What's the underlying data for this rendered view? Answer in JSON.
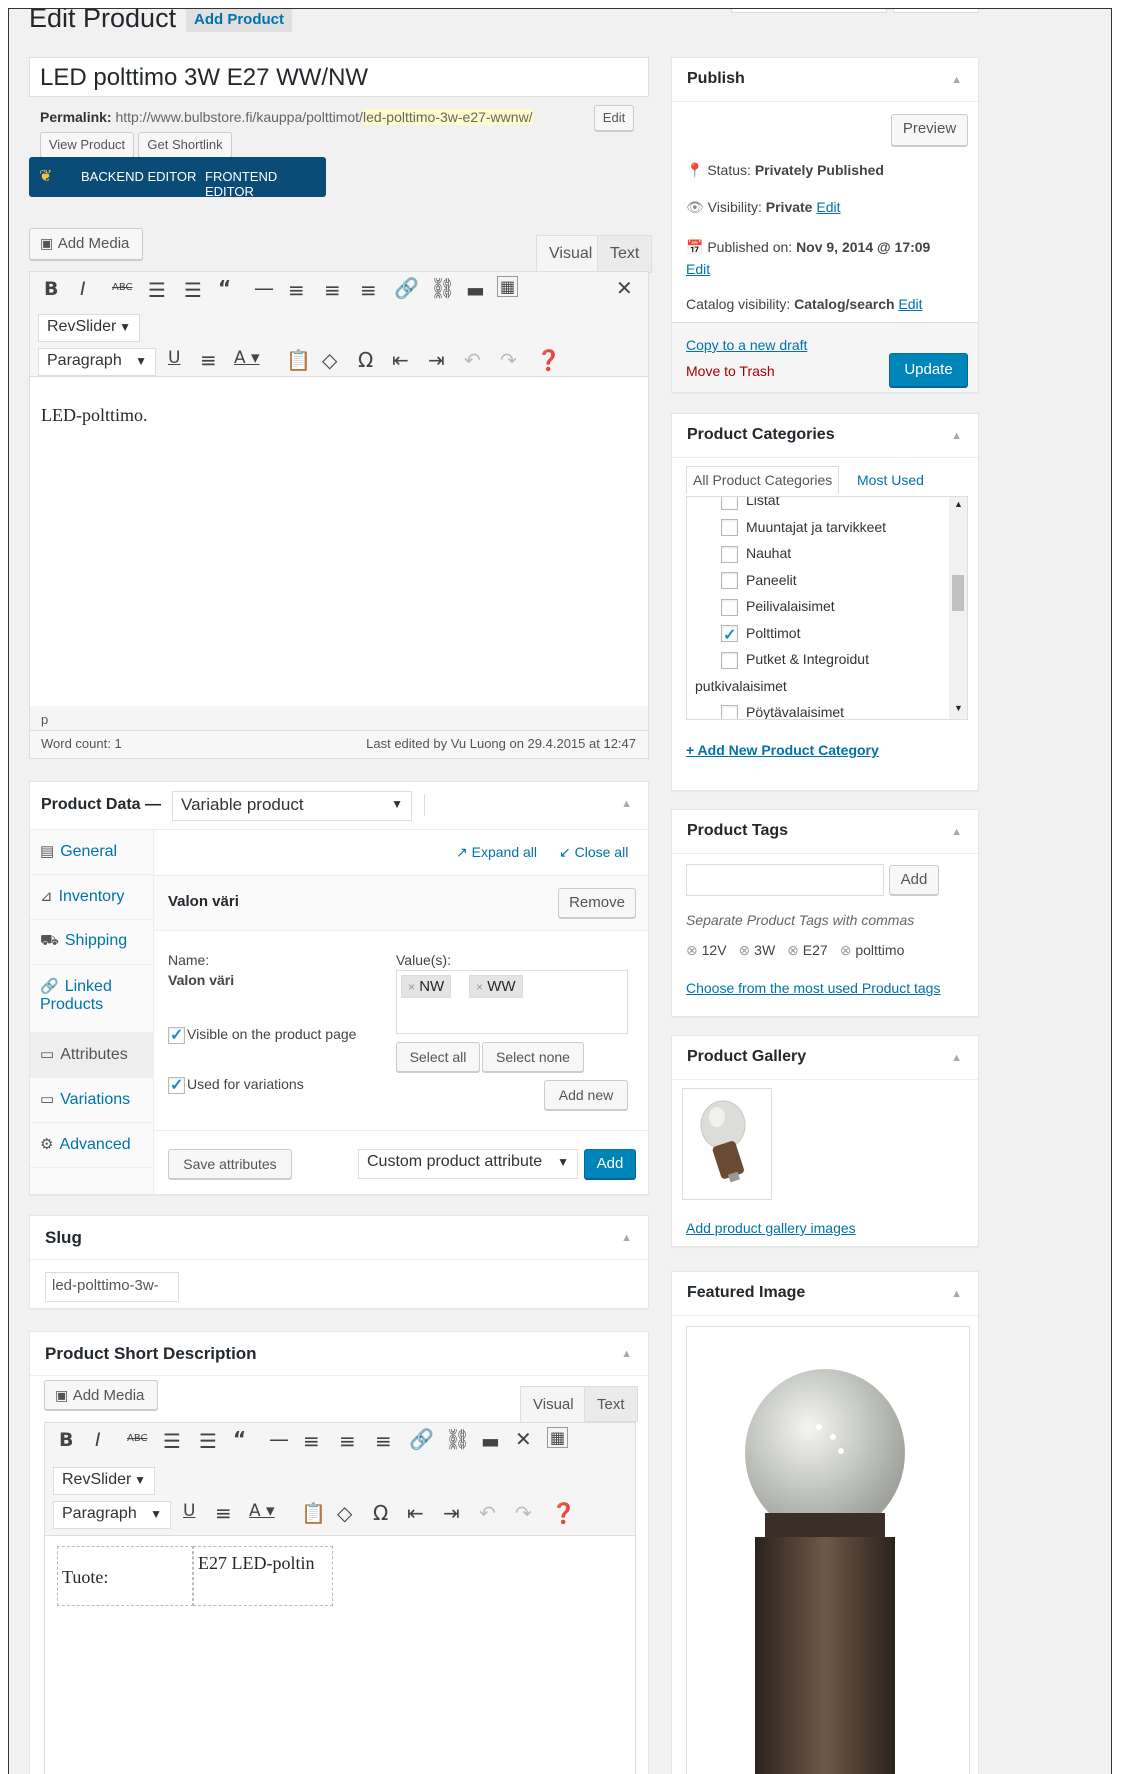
{
  "page": {
    "title": "Edit Product",
    "add_new": "Add Product"
  },
  "post": {
    "title": "LED polttimo 3W E27 WW/NW",
    "permalink_label": "Permalink:",
    "permalink_base": "http://www.bulbstore.fi/kauppa/polttimot/",
    "permalink_slug": "led-polttimo-3w-e27-wwnw/",
    "edit_label": "Edit",
    "view_product": "View Product",
    "get_shortlink": "Get Shortlink"
  },
  "composer": {
    "backend": "BACKEND EDITOR",
    "frontend": "FRONTEND EDITOR"
  },
  "editor": {
    "add_media": "Add Media",
    "tab_visual": "Visual",
    "tab_text": "Text",
    "revslider": "RevSlider",
    "format": "Paragraph",
    "content": "LED-polttimo.",
    "path": "p",
    "word_count": "Word count: 1",
    "last_edited": "Last edited by Vu Luong on 29.4.2015 at 12:47"
  },
  "product_data": {
    "label": "Product Data —",
    "type": "Variable product",
    "tabs": [
      "General",
      "Inventory",
      "Shipping",
      "Linked Products",
      "Attributes",
      "Variations",
      "Advanced"
    ],
    "expand_all": "Expand all",
    "close_all": "Close all",
    "attribute_title": "Valon väri",
    "remove": "Remove",
    "name_label": "Name:",
    "name_value": "Valon väri",
    "values_label": "Value(s):",
    "values": [
      "NW",
      "WW"
    ],
    "visible_label": "Visible on the product page",
    "variations_label": "Used for variations",
    "select_all": "Select all",
    "select_none": "Select none",
    "add_new": "Add new",
    "save_attributes": "Save attributes",
    "custom_attribute": "Custom product attribute",
    "add": "Add"
  },
  "slug": {
    "title": "Slug",
    "value": "led-polttimo-3w-"
  },
  "short_desc": {
    "title": "Product Short Description",
    "add_media": "Add Media",
    "tab_visual": "Visual",
    "tab_text": "Text",
    "revslider": "RevSlider",
    "format": "Paragraph",
    "cell1": "Tuote:",
    "cell2": "E27 LED-poltin"
  },
  "publish": {
    "title": "Publish",
    "preview": "Preview",
    "status_label": "Status:",
    "status_value": "Privately Published",
    "visibility_label": "Visibility:",
    "visibility_value": "Private",
    "edit": "Edit",
    "published_label": "Published on:",
    "published_value": "Nov 9, 2014 @ 17:09",
    "catalog_label": "Catalog visibility:",
    "catalog_value": "Catalog/search",
    "copy_draft": "Copy to a new draft",
    "trash": "Move to Trash",
    "update": "Update"
  },
  "categories": {
    "title": "Product Categories",
    "tab_all": "All Product Categories",
    "tab_used": "Most Used",
    "items": [
      {
        "label": "Listat",
        "checked": false
      },
      {
        "label": "Muuntajat ja tarvikkeet",
        "checked": false
      },
      {
        "label": "Nauhat",
        "checked": false
      },
      {
        "label": "Paneelit",
        "checked": false
      },
      {
        "label": "Peilivalaisimet",
        "checked": false
      },
      {
        "label": "Polttimot",
        "checked": true
      },
      {
        "label": "Putket & Integroidut",
        "checked": false
      },
      {
        "label": "putkivalaisimet",
        "checked": false
      },
      {
        "label": "Pöytävalaisimet",
        "checked": false
      }
    ],
    "add_new": "+ Add New Product Category"
  },
  "tags": {
    "title": "Product Tags",
    "add": "Add",
    "hint": "Separate Product Tags with commas",
    "items": [
      "12V",
      "3W",
      "E27",
      "polttimo"
    ],
    "choose": "Choose from the most used Product tags"
  },
  "gallery": {
    "title": "Product Gallery",
    "add": "Add product gallery images"
  },
  "featured": {
    "title": "Featured Image"
  },
  "icons": {
    "publish_toggle": "triangle-up",
    "status": "pin-icon",
    "visibility": "eye-icon",
    "calendar": "calendar-icon"
  },
  "colors": {
    "accent": "#0085ba",
    "link": "#0073aa",
    "trash": "#a00",
    "composer": "#0a4b78",
    "highlight": "#fffbcc"
  }
}
